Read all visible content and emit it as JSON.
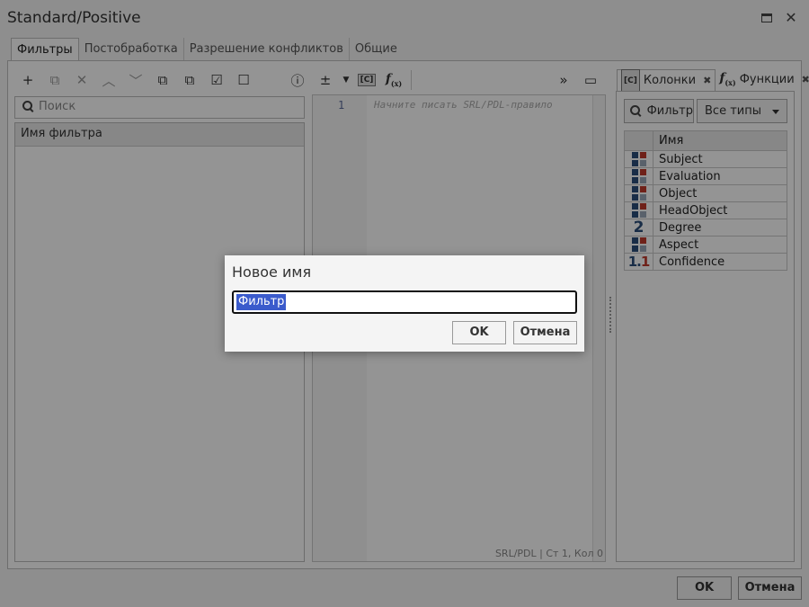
{
  "window": {
    "title": "Standard/Positive"
  },
  "tabs": [
    "Фильтры",
    "Постобработка",
    "Разрешение конфликтов",
    "Общие"
  ],
  "left_panel": {
    "search_placeholder": "Поиск",
    "list_header": "Имя фильтра"
  },
  "editor": {
    "line_number": "1",
    "placeholder": "Начните писать SRL/PDL-правило",
    "status": "SRL/PDL | Ст 1, Кол 0"
  },
  "right_panel": {
    "tab_columns": "Колонки",
    "tab_functions": "Функции",
    "tab_columns_icon": "[C]",
    "filter_button": "Фильтр",
    "types_select": "Все типы",
    "table_header": "Имя",
    "columns": [
      {
        "name": "Subject",
        "icon": "grid"
      },
      {
        "name": "Evaluation",
        "icon": "grid"
      },
      {
        "name": "Object",
        "icon": "grid"
      },
      {
        "name": "HeadObject",
        "icon": "grid"
      },
      {
        "name": "Degree",
        "icon": "2"
      },
      {
        "name": "Aspect",
        "icon": "grid"
      },
      {
        "name": "Confidence",
        "icon": "1.1"
      }
    ]
  },
  "footer": {
    "ok": "OK",
    "cancel": "Отмена"
  },
  "dialog": {
    "title": "Новое имя",
    "value": "Фильтр",
    "ok": "OK",
    "cancel": "Отмена"
  }
}
